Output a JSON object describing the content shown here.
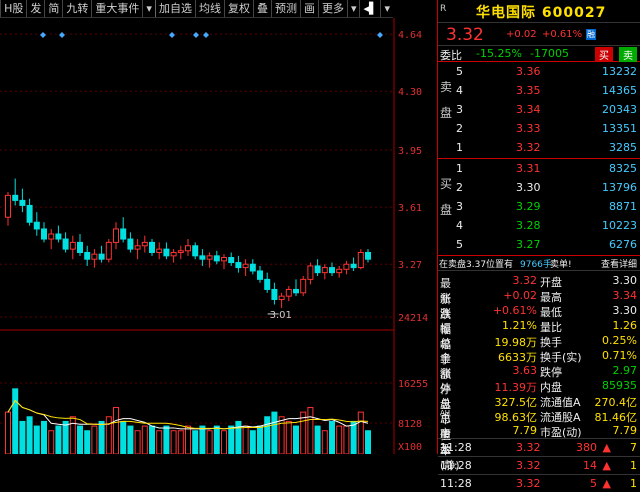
{
  "toolbar": {
    "items": [
      "H股",
      "发",
      "简",
      "九转",
      "重大事件",
      "加自选",
      "均线",
      "复权",
      "叠",
      "预测",
      "画",
      "更多"
    ]
  },
  "chart_data": {
    "type": "candlestick",
    "y_ticks": [
      "4.64",
      "4.30",
      "3.95",
      "3.61",
      "3.27"
    ],
    "volume_ticks": [
      "24214",
      "16255",
      "8128",
      "X100"
    ],
    "low_annotation": "3.01",
    "candles": [
      [
        3.55,
        3.7,
        3.5,
        3.68
      ],
      [
        3.68,
        3.78,
        3.62,
        3.65
      ],
      [
        3.65,
        3.72,
        3.58,
        3.62
      ],
      [
        3.62,
        3.66,
        3.5,
        3.52
      ],
      [
        3.52,
        3.58,
        3.44,
        3.48
      ],
      [
        3.48,
        3.52,
        3.4,
        3.42
      ],
      [
        3.42,
        3.48,
        3.36,
        3.45
      ],
      [
        3.45,
        3.5,
        3.4,
        3.42
      ],
      [
        3.42,
        3.46,
        3.34,
        3.36
      ],
      [
        3.36,
        3.44,
        3.3,
        3.4
      ],
      [
        3.4,
        3.45,
        3.32,
        3.34
      ],
      [
        3.34,
        3.38,
        3.26,
        3.3
      ],
      [
        3.3,
        3.36,
        3.25,
        3.33
      ],
      [
        3.33,
        3.38,
        3.28,
        3.3
      ],
      [
        3.3,
        3.42,
        3.28,
        3.4
      ],
      [
        3.4,
        3.52,
        3.36,
        3.48
      ],
      [
        3.48,
        3.55,
        3.4,
        3.42
      ],
      [
        3.42,
        3.46,
        3.34,
        3.36
      ],
      [
        3.36,
        3.42,
        3.3,
        3.38
      ],
      [
        3.38,
        3.44,
        3.34,
        3.4
      ],
      [
        3.4,
        3.42,
        3.32,
        3.34
      ],
      [
        3.34,
        3.4,
        3.3,
        3.36
      ],
      [
        3.36,
        3.4,
        3.3,
        3.32
      ],
      [
        3.32,
        3.36,
        3.28,
        3.34
      ],
      [
        3.34,
        3.38,
        3.3,
        3.35
      ],
      [
        3.35,
        3.42,
        3.32,
        3.38
      ],
      [
        3.38,
        3.4,
        3.3,
        3.32
      ],
      [
        3.32,
        3.36,
        3.26,
        3.3
      ],
      [
        3.3,
        3.34,
        3.25,
        3.32
      ],
      [
        3.32,
        3.35,
        3.27,
        3.29
      ],
      [
        3.29,
        3.33,
        3.24,
        3.31
      ],
      [
        3.31,
        3.34,
        3.26,
        3.28
      ],
      [
        3.28,
        3.32,
        3.22,
        3.25
      ],
      [
        3.25,
        3.3,
        3.2,
        3.27
      ],
      [
        3.27,
        3.3,
        3.21,
        3.23
      ],
      [
        3.23,
        3.26,
        3.16,
        3.18
      ],
      [
        3.18,
        3.22,
        3.1,
        3.12
      ],
      [
        3.12,
        3.16,
        3.03,
        3.06
      ],
      [
        3.06,
        3.1,
        3.01,
        3.08
      ],
      [
        3.08,
        3.14,
        3.05,
        3.12
      ],
      [
        3.12,
        3.18,
        3.08,
        3.1
      ],
      [
        3.1,
        3.2,
        3.08,
        3.18
      ],
      [
        3.18,
        3.28,
        3.15,
        3.26
      ],
      [
        3.26,
        3.3,
        3.2,
        3.22
      ],
      [
        3.22,
        3.27,
        3.18,
        3.25
      ],
      [
        3.25,
        3.28,
        3.2,
        3.22
      ],
      [
        3.22,
        3.26,
        3.19,
        3.24
      ],
      [
        3.24,
        3.29,
        3.21,
        3.27
      ],
      [
        3.27,
        3.31,
        3.23,
        3.25
      ],
      [
        3.25,
        3.36,
        3.24,
        3.34
      ],
      [
        3.34,
        3.36,
        3.28,
        3.3
      ]
    ],
    "volumes": [
      9,
      14,
      7,
      8,
      6,
      7,
      5,
      6,
      7,
      8,
      6,
      5,
      6,
      7,
      8,
      10,
      7,
      6,
      5,
      6,
      6,
      5,
      6,
      5,
      5,
      6,
      5,
      6,
      5,
      6,
      5,
      6,
      7,
      6,
      5,
      6,
      8,
      9,
      8,
      7,
      6,
      9,
      10,
      6,
      5,
      7,
      6,
      6,
      7,
      9,
      5
    ],
    "markers": [
      43,
      62,
      172,
      196,
      206,
      380
    ]
  },
  "quote": {
    "r_label": "R",
    "name": "华电国际",
    "code": "600027",
    "price": "3.32",
    "change": "+0.02",
    "change_pct": "+0.61%",
    "rong": "融",
    "weibi_label": "委比",
    "weibi": "-15.25%",
    "weicha": "-17005",
    "buy_btn": "买",
    "sell_btn": "卖",
    "sell_label": "卖盘",
    "buy_label": "买盘",
    "asks": [
      {
        "lvl": "5",
        "price": "3.36",
        "vol": "13232"
      },
      {
        "lvl": "4",
        "price": "3.35",
        "vol": "14365"
      },
      {
        "lvl": "3",
        "price": "3.34",
        "vol": "20343"
      },
      {
        "lvl": "2",
        "price": "3.33",
        "vol": "13351"
      },
      {
        "lvl": "1",
        "price": "3.32",
        "vol": "3285"
      }
    ],
    "bids": [
      {
        "lvl": "1",
        "price": "3.31",
        "vol": "8325"
      },
      {
        "lvl": "2",
        "price": "3.30",
        "vol": "13796"
      },
      {
        "lvl": "3",
        "price": "3.29",
        "vol": "8871"
      },
      {
        "lvl": "4",
        "price": "3.28",
        "vol": "10223"
      },
      {
        "lvl": "5",
        "price": "3.27",
        "vol": "6276"
      }
    ],
    "msg_prefix": "在卖盘3.37位置有",
    "msg_vol": "9766手",
    "msg_suffix": "卖单!",
    "msg_link": "查看详细",
    "stats": [
      {
        "l1": "最新",
        "v1": "3.32",
        "l2": "开盘",
        "v2": "3.30"
      },
      {
        "l1": "涨跌",
        "v1": "+0.02",
        "l2": "最高",
        "v2": "3.34"
      },
      {
        "l1": "涨幅",
        "v1": "+0.61%",
        "l2": "最低",
        "v2": "3.30"
      },
      {
        "l1": "振幅",
        "v1": "1.21%",
        "l2": "量比",
        "v2": "1.26"
      },
      {
        "l1": "总手",
        "v1": "19.98万",
        "l2": "换手",
        "v2": "0.25%"
      },
      {
        "l1": "金额",
        "v1": "6633万",
        "l2": "换手(实)",
        "v2": "0.71%"
      },
      {
        "l1": "涨停",
        "v1": "3.63",
        "l2": "跌停",
        "v2": "2.97"
      },
      {
        "l1": "外盘",
        "v1": "11.39万",
        "l2": "内盘",
        "v2": "85935"
      },
      {
        "l1": "总市值",
        "v1": "327.5亿",
        "l2": "流通值A",
        "v2": "270.4亿"
      },
      {
        "l1": "总股本",
        "v1": "98.63亿",
        "l2": "流通股A",
        "v2": "81.46亿"
      },
      {
        "l1": "市盈(静)",
        "v1": "7.79",
        "l2": "市盈(动)",
        "v2": "7.79"
      }
    ],
    "ah_tag": "AH",
    "ticks": [
      {
        "time": "11:28",
        "price": "3.32",
        "vol": "380",
        "count": "7"
      },
      {
        "time": "11:28",
        "price": "3.32",
        "vol": "14",
        "count": "1"
      },
      {
        "time": "11:28",
        "price": "3.32",
        "vol": "5",
        "count": "1"
      }
    ]
  }
}
